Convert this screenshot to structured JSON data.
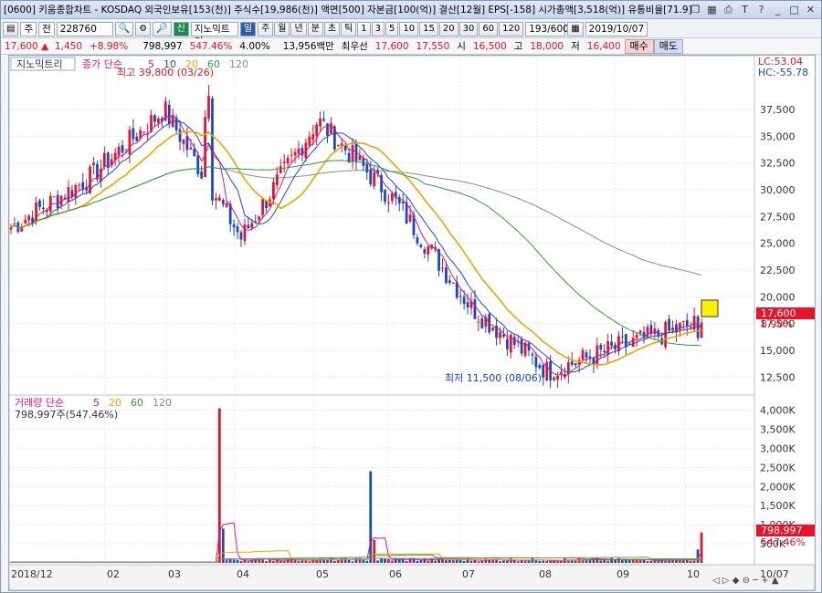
{
  "titlebar": {
    "text": "[0600] 키움종합차트 - KOSDAQ 외국인보유[153(천)] 주식수[19,986(천)] 액면[500] 자본금[100(억)] 결산[12월] EPS[-158] 시가총액[3,518(억)] 유통비율[71.9]",
    "icons": [
      "window-number-icon",
      "restore-icon",
      "grid-icon",
      "print-icon",
      "text-icon",
      "help-icon",
      "minimize-icon",
      "maximize-icon",
      "close-icon"
    ]
  },
  "toolbar": {
    "period": "주",
    "unit": "전",
    "code": "228760",
    "stock_name": "지노믹트리",
    "stock_badge": "신",
    "mode_btn": "일",
    "periods": [
      "주",
      "월",
      "년",
      "분",
      "초",
      "틱",
      "1",
      "3",
      "5",
      "10",
      "15",
      "20",
      "30",
      "60",
      "120"
    ],
    "count": "193/600",
    "date": "2019/10/07"
  },
  "quote": {
    "price": "17,600",
    "change": "1,450",
    "change_pct": "+8.98%",
    "volume": "798,997",
    "volume_pct": "547.46%",
    "turnover": "4.00%",
    "amount": "13,956백만",
    "best_label": "최우선",
    "best_ask": "17,600",
    "best_bid": "17,550",
    "open_label": "시",
    "open": "16,500",
    "high_label": "고",
    "high": "18,000",
    "low_label": "저",
    "low": "16,400",
    "buy_label": "매수",
    "sell_label": "매도"
  },
  "price_panel": {
    "stock_label": "지노믹트리",
    "legend_head": "종가 단순",
    "ma_periods": [
      "5",
      "10",
      "20",
      "60",
      "120"
    ],
    "ma_colors": [
      "#e0157f",
      "#2a44c8",
      "#f0a300",
      "#2e9b40",
      "#8a8a8a"
    ],
    "high_annotation": "최고 39,800 (03/26)",
    "low_annotation": "최저 11,500 (08/06)",
    "lc_label": "LC:53.04",
    "hc_label": "HC:-55.78",
    "last_price_tag": "17,600",
    "last_pct_tag": "8.98%"
  },
  "volume_panel": {
    "legend_head": "거래량 단순",
    "ma_periods": [
      "5",
      "20",
      "60",
      "120"
    ],
    "ma_colors": [
      "#e0157f",
      "#f0a300",
      "#2e9b40",
      "#8a8a8a"
    ],
    "summary": "798,997주(547.46%)",
    "last_volume_tag": "798,997",
    "last_pct_tag": "547.46%"
  },
  "axis": {
    "x_labels": [
      "2018/12",
      "02",
      "03",
      "04",
      "05",
      "06",
      "07",
      "08",
      "09",
      "10",
      "10/07"
    ],
    "price_ticks": [
      "37,500",
      "35,000",
      "32,500",
      "30,000",
      "27,500",
      "25,000",
      "22,500",
      "20,000",
      "17,500",
      "15,000",
      "12,500"
    ],
    "volume_ticks": [
      "4,000K",
      "3,500K",
      "3,000K",
      "2,500K",
      "2,000K",
      "1,500K",
      "1,000K",
      "500K"
    ]
  },
  "colors": {
    "up": "#e8132a",
    "down": "#1448c8",
    "accent": "#2b5aa8"
  },
  "chart_data": {
    "type": "candlestick",
    "period_start": "2018/12",
    "period_end": "2019/10/07",
    "price_range": [
      11000,
      41000
    ],
    "volume_range": [
      0,
      4300
    ],
    "monthly_closes": [
      {
        "x": "2018/12",
        "close": 26500
      },
      {
        "x": "02",
        "close": 31000
      },
      {
        "x": "03",
        "close": 37500
      },
      {
        "x": "04",
        "close": 25500
      },
      {
        "x": "05",
        "close": 36500
      },
      {
        "x": "06",
        "close": 29000
      },
      {
        "x": "07",
        "close": 19000
      },
      {
        "x": "08",
        "close": 13000
      },
      {
        "x": "09",
        "close": 15500
      },
      {
        "x": "10",
        "close": 17600
      }
    ],
    "high": {
      "value": 39800,
      "date": "03/26"
    },
    "low": {
      "value": 11500,
      "date": "08/06"
    },
    "last": {
      "close": 17600,
      "open": 16500,
      "high": 18000,
      "low": 16400,
      "volume_k": 799
    }
  }
}
